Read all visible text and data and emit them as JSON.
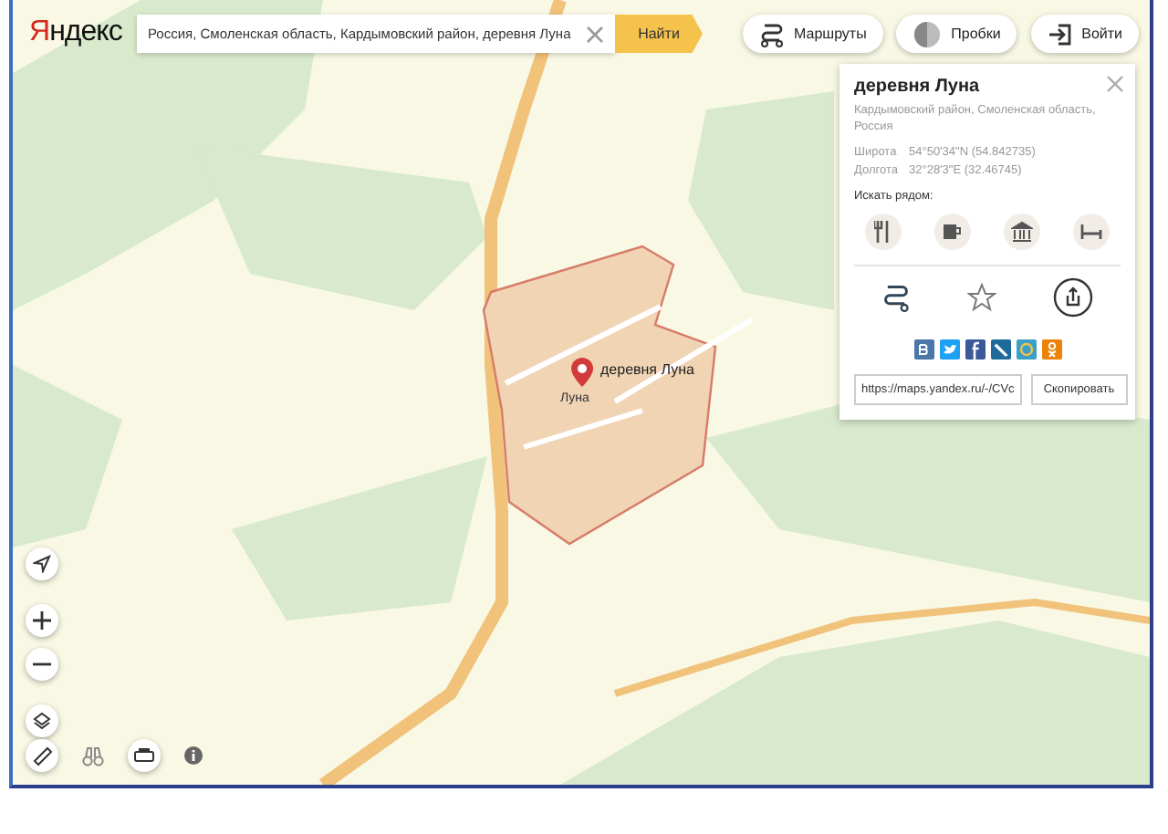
{
  "logo": "Яндекс",
  "search": {
    "value": "Россия, Смоленская область, Кардымовский район, деревня Луна",
    "button": "Найти"
  },
  "top_buttons": [
    {
      "kind": "routes",
      "label": "Маршруты"
    },
    {
      "kind": "traffic",
      "label": "Пробки"
    },
    {
      "kind": "login",
      "label": "Войти"
    }
  ],
  "map": {
    "place_label": "деревня Луна",
    "village_label": "Луна"
  },
  "card": {
    "title": "деревня Луна",
    "subtitle": "Кардымовский район, Смоленская область, Россия",
    "coords": [
      {
        "label": "Широта",
        "value": "54°50'34\"N (54.842735)"
      },
      {
        "label": "Долгота",
        "value": "32°28'3\"E (32.46745)"
      }
    ],
    "nearby_title": "Искать рядом:",
    "nearby": [
      {
        "kind": "restaurant"
      },
      {
        "kind": "cafe"
      },
      {
        "kind": "museum"
      },
      {
        "kind": "hotel"
      }
    ],
    "share": [
      {
        "kind": "vk",
        "color": "#4a76a8"
      },
      {
        "kind": "twitter",
        "color": "#1da1f2"
      },
      {
        "kind": "facebook",
        "color": "#3b5998"
      },
      {
        "kind": "lj",
        "color": "#1e6b9a"
      },
      {
        "kind": "mail",
        "color": "#3aa0c8"
      },
      {
        "kind": "ok",
        "color": "#ee8208"
      }
    ],
    "url": "https://maps.yandex.ru/-/CVc",
    "copy_button": "Скопировать"
  }
}
